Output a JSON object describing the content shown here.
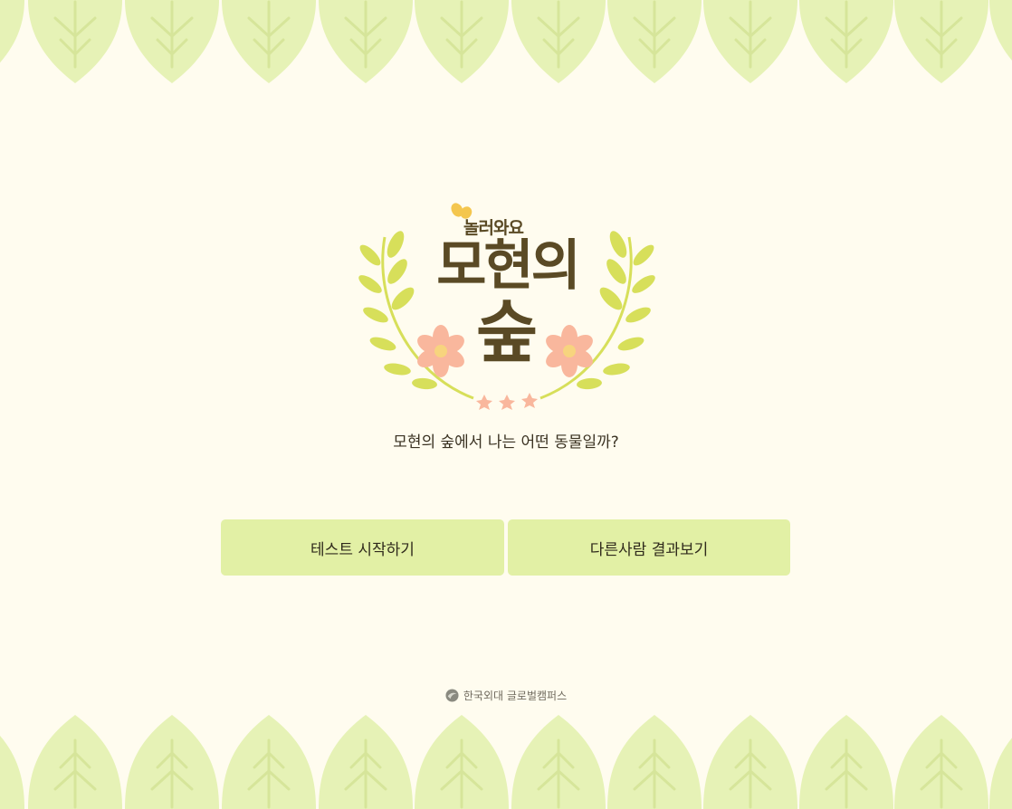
{
  "logo": {
    "sub_title": "놀러와요",
    "title_line1": "모현의",
    "title_line2": "숲"
  },
  "subtitle": "모현의 숲에서 나는 어떤 동물일까?",
  "buttons": {
    "start_label": "테스트 시작하기",
    "results_label": "다른사람 결과보기"
  },
  "footer": {
    "text": "한국외대 글로벌캠퍼스"
  },
  "colors": {
    "background": "#fffcef",
    "button_bg": "#e2f0a5",
    "leaf": "#e6f2b6",
    "laurel": "#d7df5a",
    "flower": "#f9b79d",
    "logo_text": "#5a4a25"
  }
}
